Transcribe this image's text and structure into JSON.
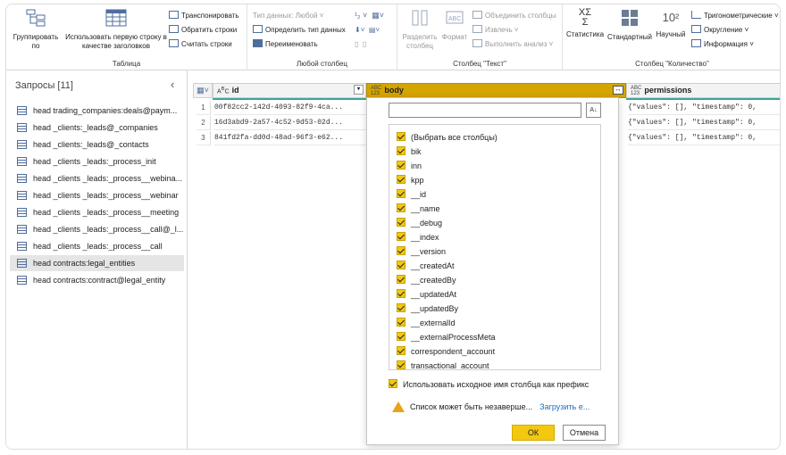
{
  "ribbon": {
    "table_group": {
      "label": "Таблица",
      "group_by": "Группировать по",
      "use_first_row": "Использовать первую строку в качестве заголовков",
      "transpose": "Транспонировать",
      "reverse_rows": "Обратить строки",
      "count_rows": "Считать строки"
    },
    "any_column_group": {
      "label": "Любой столбец",
      "data_type": "Тип данных: Любой",
      "detect_type": "Определить тип данных",
      "rename": "Переименовать"
    },
    "text_column_group": {
      "label": "Столбец \"Текст\"",
      "split_column": "Разделить столбец",
      "format": "Формат",
      "merge_columns": "Объединить столбцы",
      "extract": "Извлечь",
      "run_analysis": "Выполнить анализ"
    },
    "number_column_group": {
      "label": "Столбец \"Количество\"",
      "statistics": "Статистика",
      "standard": "Стандартный",
      "scientific": "Научный",
      "trigonometric": "Тригонометрические",
      "rounding": "Округление",
      "information": "Информация"
    }
  },
  "queries": {
    "title": "Запросы [11]",
    "items": [
      {
        "label": "head trading_companies:deals@paym..."
      },
      {
        "label": "head _clients:_leads@_companies"
      },
      {
        "label": "head _clients:_leads@_contacts"
      },
      {
        "label": "head _clients _leads:_process_init"
      },
      {
        "label": "head _clients _leads:_process__webina..."
      },
      {
        "label": "head _clients _leads:_process__webinar"
      },
      {
        "label": "head _clients _leads:_process__meeting"
      },
      {
        "label": "head _clients _leads:_process__call@_l..."
      },
      {
        "label": "head _clients _leads:_process__call"
      },
      {
        "label": "head contracts:legal_entities"
      },
      {
        "label": "head contracts:contract@legal_entity"
      }
    ],
    "selected_index": 9
  },
  "grid": {
    "columns": {
      "id": "id",
      "body": "body",
      "permissions": "permissions"
    },
    "rows": [
      {
        "num": "1",
        "id": "00f82cc2-142d-4093-82f9-4ca...",
        "permissions": "{\"values\": [], \"timestamp\": 0,"
      },
      {
        "num": "2",
        "id": "16d3abd9-2a57-4c52-9d53-02d...",
        "permissions": "{\"values\": [], \"timestamp\": 0,"
      },
      {
        "num": "3",
        "id": "841fd2fa-dd0d-48ad-96f3-e62...",
        "permissions": "{\"values\": [], \"timestamp\": 0,"
      }
    ]
  },
  "expand_panel": {
    "search_value": "",
    "select_all": "(Выбрать все столбцы)",
    "fields": [
      "bik",
      "inn",
      "kpp",
      "__id",
      "__name",
      "__debug",
      "__index",
      "__version",
      "__createdAt",
      "__createdBy",
      "__updatedAt",
      "__updatedBy",
      "__externalId",
      "__externalProcessMeta",
      "correspondent_account",
      "transactional_account"
    ],
    "use_prefix": "Использовать исходное имя столбца как префикс",
    "warning": "Список может быть незаверше...",
    "load_more": "Загрузить е...",
    "ok": "ОК",
    "cancel": "Отмена"
  },
  "colors": {
    "accent": "#f2c811",
    "active_header": "#d4a400",
    "row_teal": "#3aa59b"
  }
}
